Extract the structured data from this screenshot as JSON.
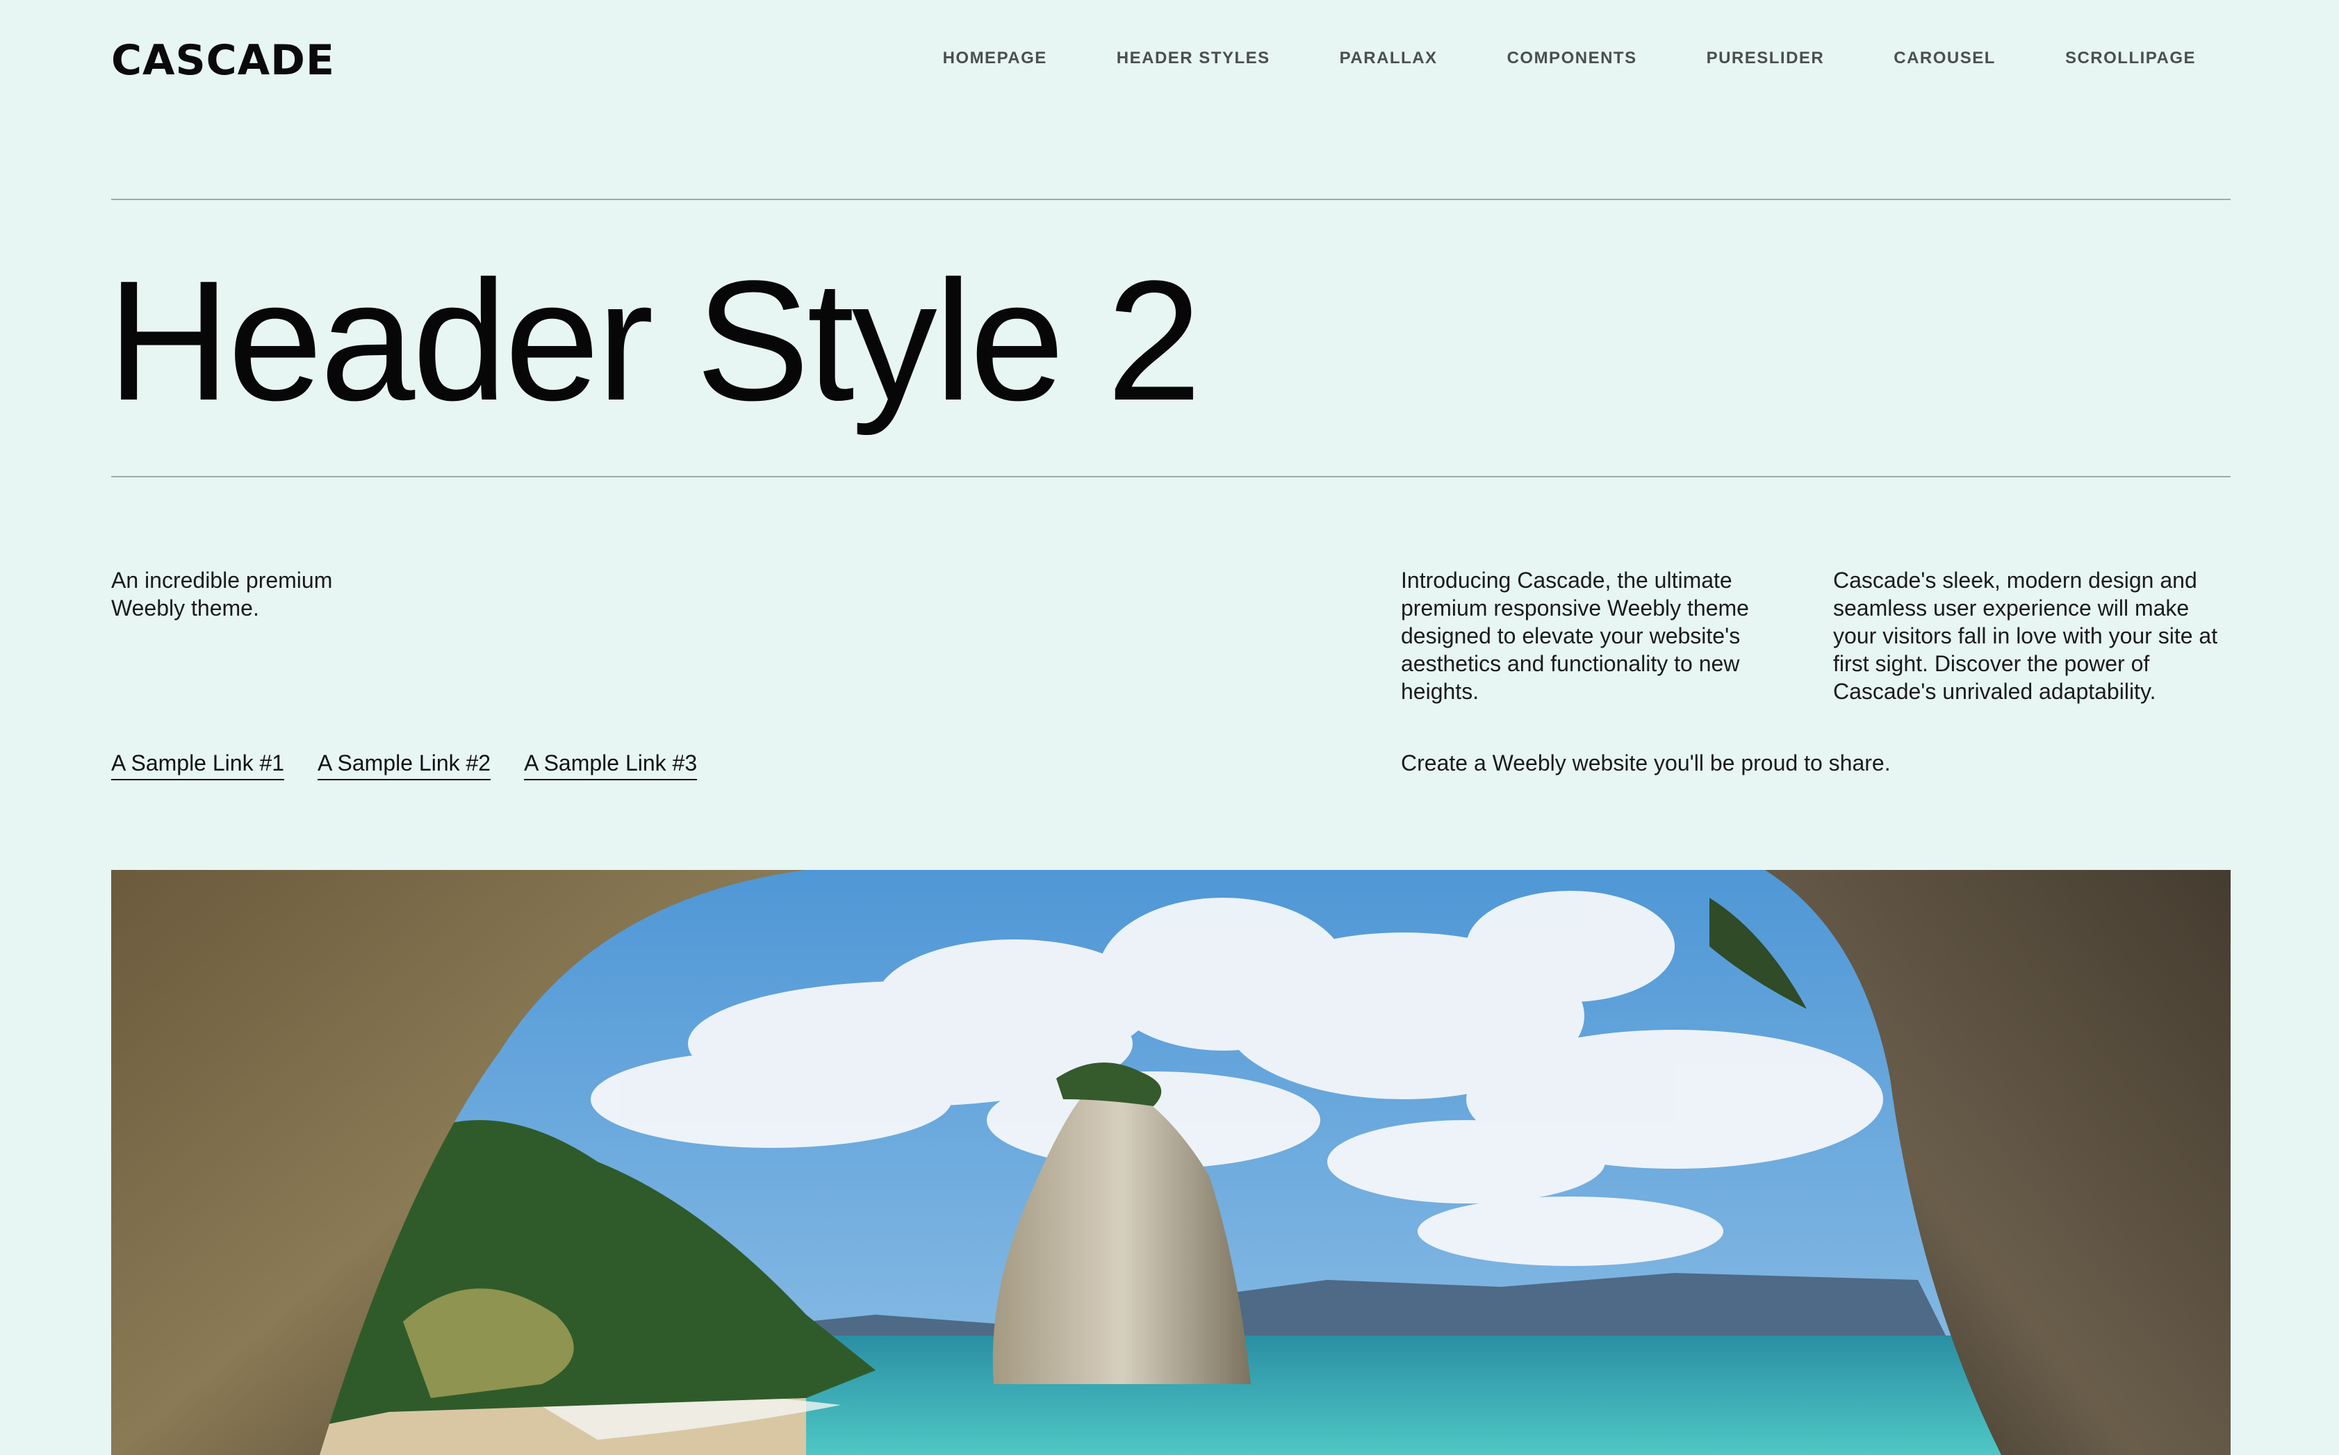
{
  "brand": {
    "logo": "CASCADE"
  },
  "nav": {
    "items": [
      "HOMEPAGE",
      "HEADER STYLES",
      "PARALLAX",
      "COMPONENTS",
      "PURESLIDER",
      "CAROUSEL",
      "SCROLLIPAGE"
    ]
  },
  "page": {
    "title": "Header Style 2",
    "tagline": "An incredible premium Weebly theme.",
    "links": [
      "A Sample Link #1",
      "A Sample Link #2",
      "A Sample Link #3"
    ],
    "intro": "Introducing Cascade, the ultimate premium responsive Weebly theme designed to elevate your website's aesthetics and functionality to new heights.",
    "design": "Cascade's sleek, modern design and seamless user experience will make your visitors fall in love with your site at first sight. Discover the power of Cascade's unrivaled adaptability.",
    "cta": "Create a Weebly website you'll be proud to share."
  },
  "colors": {
    "background": "#e7f5f3",
    "text": "#0d0d0d",
    "nav_text": "#4a4f4f",
    "rule": "#9fa9a8"
  }
}
